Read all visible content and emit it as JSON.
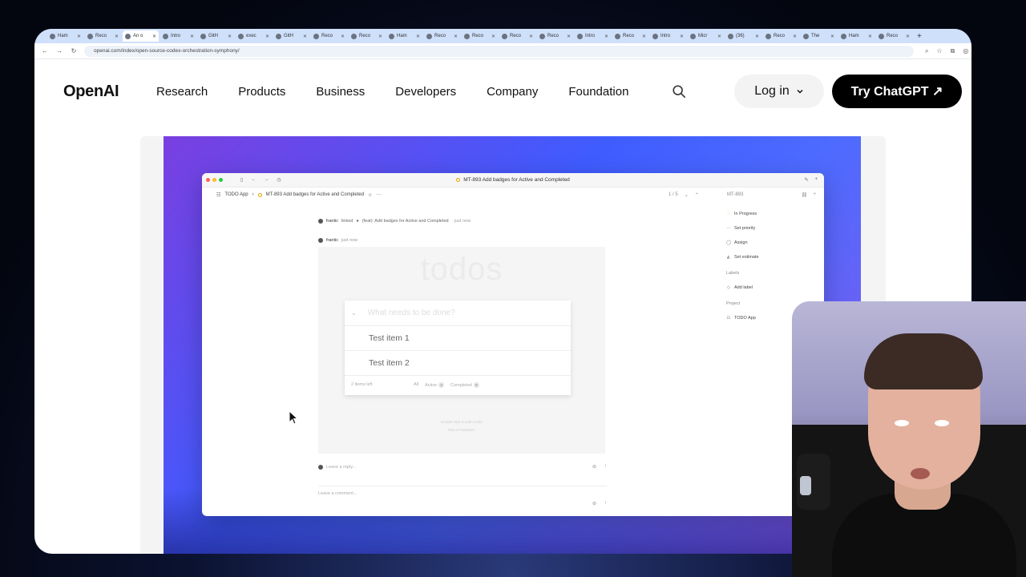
{
  "browser": {
    "tabs": [
      {
        "label": "Ham"
      },
      {
        "label": "Reco"
      },
      {
        "label": "An o"
      },
      {
        "label": "Intro"
      },
      {
        "label": "GitH"
      },
      {
        "label": "exec"
      },
      {
        "label": "GitH"
      },
      {
        "label": "Reco"
      },
      {
        "label": "Reco"
      },
      {
        "label": "Ham"
      },
      {
        "label": "Reco"
      },
      {
        "label": "Reco"
      },
      {
        "label": "Reco"
      },
      {
        "label": "Reco"
      },
      {
        "label": "Intro"
      },
      {
        "label": "Reco"
      },
      {
        "label": "Intro"
      },
      {
        "label": "Micr"
      },
      {
        "label": "(36)"
      },
      {
        "label": "Reco"
      },
      {
        "label": "The"
      },
      {
        "label": "Ham"
      },
      {
        "label": "Reco"
      }
    ],
    "url": "openai.com/index/open-source-codex-orchestration-symphony/"
  },
  "header": {
    "logo": "OpenAI",
    "nav": [
      "Research",
      "Products",
      "Business",
      "Developers",
      "Company",
      "Foundation"
    ],
    "login_label": "Log in",
    "cta_label": "Try ChatGPT ↗"
  },
  "app": {
    "window_title": "MT-893 Add badges for Active and Completed",
    "crumb_project": "TODO App",
    "crumb_issue": "MT-893 Add badges for Active and Completed",
    "pager": "1 / 5",
    "issue_id": "MT-893",
    "sidebar": {
      "status": "In Progress",
      "priority": "Set priority",
      "assign": "Assign",
      "estimate": "Set estimate",
      "labels_head": "Labels",
      "add_label": "Add label",
      "project_head": "Project",
      "project": "TODO App"
    },
    "activity": {
      "row1_user": "frantic",
      "row1_text": "linked",
      "row1_commit": "(feat): Add badges for Active and Completed",
      "row1_time": "· just now",
      "row2_user": "frantic",
      "row2_time": "just now"
    },
    "todo": {
      "title": "todos",
      "placeholder": "What needs to be done?",
      "items": [
        "Test item 1",
        "Test item 2"
      ],
      "items_left": "2 items left",
      "filter_all": "All",
      "filter_active": "Active",
      "active_count": "2",
      "filter_completed": "Completed",
      "completed_count": "0",
      "fine1": "Double-click to edit a todo",
      "fine2": "Part of TodoMVC"
    },
    "reply_placeholder": "Leave a reply...",
    "comment_placeholder": "Leave a comment..."
  }
}
